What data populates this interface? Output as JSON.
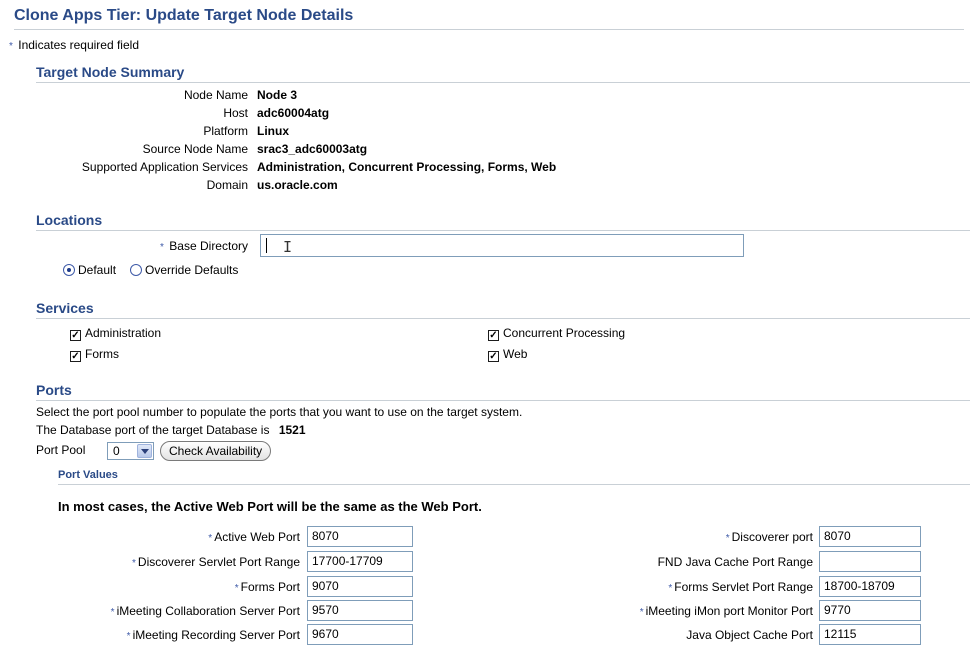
{
  "page": {
    "title": "Clone Apps Tier: Update Target Node Details",
    "required_note": "Indicates required field",
    "required_mark": "*"
  },
  "summary": {
    "heading": "Target Node Summary",
    "rows": [
      {
        "label": "Node Name",
        "value": "Node 3"
      },
      {
        "label": "Host",
        "value": "adc60004atg"
      },
      {
        "label": "Platform",
        "value": "Linux"
      },
      {
        "label": "Source Node Name",
        "value": "srac3_adc60003atg"
      },
      {
        "label": "Supported Application Services",
        "value": "Administration, Concurrent Processing, Forms, Web"
      },
      {
        "label": "Domain",
        "value": "us.oracle.com"
      }
    ]
  },
  "locations": {
    "heading": "Locations",
    "base_directory_label": "Base Directory",
    "base_directory_value": "",
    "radio_default": "Default",
    "radio_override": "Override Defaults",
    "selected": "Default"
  },
  "services": {
    "heading": "Services",
    "items": [
      {
        "label": "Administration",
        "checked": true
      },
      {
        "label": "Concurrent Processing",
        "checked": true
      },
      {
        "label": "Forms",
        "checked": true
      },
      {
        "label": "Web",
        "checked": true
      }
    ]
  },
  "ports": {
    "heading": "Ports",
    "instruction": "Select the port pool number to populate the ports that you want to use on the target system.",
    "db_port_label": "The Database port of the target Database is",
    "db_port_value": "1521",
    "pool_label": "Port Pool",
    "pool_value": "0",
    "check_button": "Check Availability",
    "values_heading": "Port Values",
    "note": "In most cases, the Active Web Port will be the same as the Web Port.",
    "left": [
      {
        "label": "Active Web Port",
        "value": "8070",
        "required": true
      },
      {
        "label": "Discoverer Servlet Port Range",
        "value": "17700-17709",
        "required": true
      },
      {
        "label": "Forms Port",
        "value": "9070",
        "required": true
      },
      {
        "label": "iMeeting Collaboration Server Port",
        "value": "9570",
        "required": true
      },
      {
        "label": "iMeeting Recording Server Port",
        "value": "9670",
        "required": true
      }
    ],
    "right": [
      {
        "label": "Discoverer port",
        "value": "8070",
        "required": true
      },
      {
        "label": "FND Java Cache Port Range",
        "value": "",
        "required": false
      },
      {
        "label": "Forms Servlet Port Range",
        "value": "18700-18709",
        "required": true
      },
      {
        "label": "iMeeting iMon port Monitor Port",
        "value": "9770",
        "required": true
      },
      {
        "label": "Java Object Cache Port",
        "value": "12115",
        "required": false
      }
    ]
  }
}
